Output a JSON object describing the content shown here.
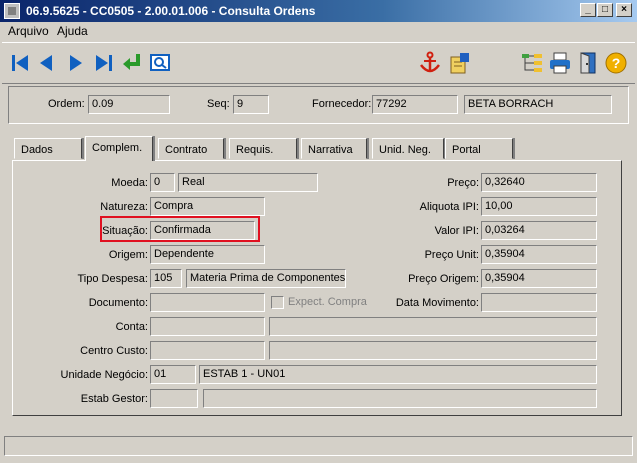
{
  "window": {
    "title": "06.9.5625 - CC0505 - 2.00.01.006 - Consulta Ordens",
    "minimize": "_",
    "maximize": "□",
    "close": "×"
  },
  "menu": {
    "items": [
      "Arquivo",
      "Ajuda"
    ]
  },
  "toolbar": {
    "left_icons": [
      "first-record-icon",
      "previous-record-icon",
      "next-record-icon",
      "last-record-icon",
      "return-icon",
      "search-icon"
    ],
    "right_icons": [
      "anchor-icon",
      "report-icon",
      "tree-icon",
      "print-icon",
      "exit-icon",
      "help-icon"
    ],
    "help_glyph": "?"
  },
  "header": {
    "ordem_label": "Ordem:",
    "ordem_value": "0.09",
    "seq_label": "Seq:",
    "seq_value": "9",
    "fornecedor_label": "Fornecedor:",
    "fornecedor_code": "77292",
    "fornecedor_name": "BETA BORRACH"
  },
  "tabs": [
    "Dados",
    "Complem.",
    "Contrato",
    "Requis.",
    "Narrativa",
    "Unid. Neg.",
    "Portal"
  ],
  "active_tab": "Complem.",
  "form": {
    "moeda_label": "Moeda:",
    "moeda_code": "0",
    "moeda_name": "Real",
    "natureza_label": "Natureza:",
    "natureza_value": "Compra",
    "situacao_label": "Situação:",
    "situacao_value": "Confirmada",
    "origem_label": "Origem:",
    "origem_value": "Dependente",
    "tipo_despesa_label": "Tipo Despesa:",
    "tipo_despesa_code": "105",
    "tipo_despesa_name": "Materia Prima de Componentes",
    "documento_label": "Documento:",
    "documento_value": "",
    "expect_compra_label": "Expect. Compra",
    "conta_label": "Conta:",
    "conta_code": "",
    "conta_name": "",
    "centro_custo_label": "Centro Custo:",
    "centro_custo_code": "",
    "centro_custo_name": "",
    "unidade_negocio_label": "Unidade Negócio:",
    "unidade_negocio_code": "01",
    "unidade_negocio_name": "ESTAB 1 - UN01",
    "estab_gestor_label": "Estab Gestor:",
    "estab_gestor_code": "",
    "estab_gestor_name": "",
    "preco_label": "Preço:",
    "preco_value": "0,32640",
    "aliquota_ipi_label": "Aliquota IPI:",
    "aliquota_ipi_value": "10,00",
    "valor_ipi_label": "Valor IPI:",
    "valor_ipi_value": "0,03264",
    "preco_unit_label": "Preço Unit:",
    "preco_unit_value": "0,35904",
    "preco_origem_label": "Preço Origem:",
    "preco_origem_value": "0,35904",
    "data_movimento_label": "Data Movimento:",
    "data_movimento_value": ""
  },
  "colors": {
    "highlight": "#e01020",
    "titlebar_start": "#0a246a",
    "titlebar_end": "#a6caf0"
  }
}
